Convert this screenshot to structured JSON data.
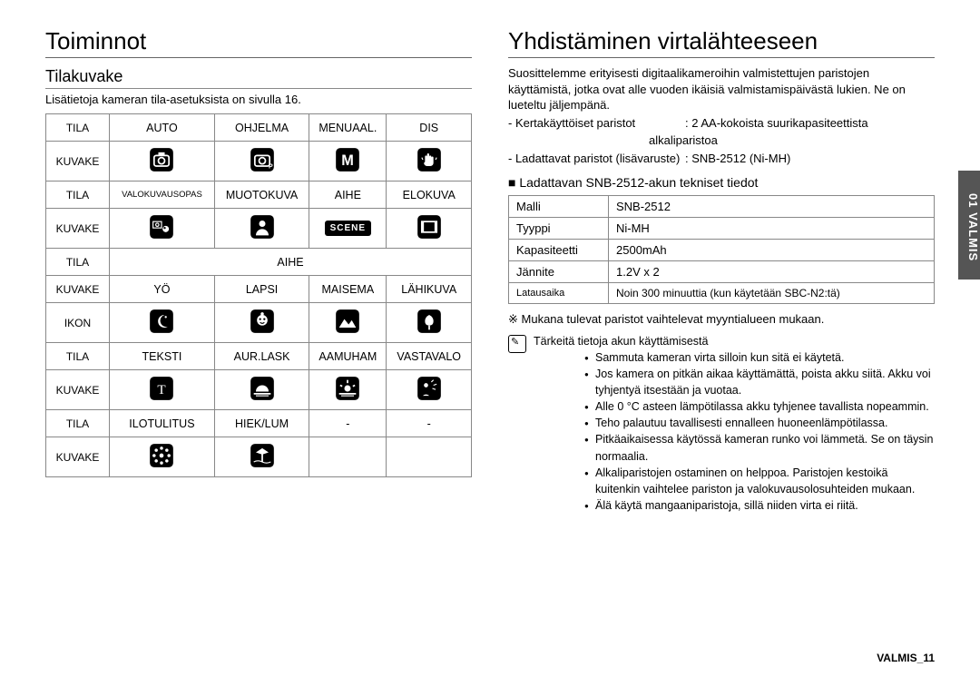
{
  "left": {
    "title": "Toiminnot",
    "subtitle": "Tilakuvake",
    "intro": "Lisätietoja kameran tila-asetuksista on sivulla 16.",
    "labels": {
      "mode": "TILA",
      "icon": "KUVAKE",
      "ikon": "IKON",
      "scene_header": "AIHE"
    },
    "modes_row1": [
      "AUTO",
      "OHJELMA",
      "MENUAAL.",
      "DIS"
    ],
    "icons_row1": [
      "camera-icon",
      "camera-p-icon",
      "letter-m-icon",
      "hand-icon"
    ],
    "modes_row2": [
      "VALOKUVAUSOPAS",
      "MUOTOKUVA",
      "AIHE",
      "ELOKUVA"
    ],
    "icons_row2": [
      "guide-icon",
      "portrait-icon",
      "scene-icon",
      "movie-icon"
    ],
    "scene_modes_row1": [
      "YÖ",
      "LAPSI",
      "MAISEMA",
      "LÄHIKUVA"
    ],
    "scene_icons_row1": [
      "night-icon",
      "child-icon",
      "landscape-icon",
      "macro-icon"
    ],
    "scene_modes_row2": [
      "TEKSTI",
      "AUR.LASK",
      "AAMUHAM",
      "VASTAVALO"
    ],
    "scene_icons_row2": [
      "text-icon",
      "sunset-icon",
      "dawn-icon",
      "backlight-icon"
    ],
    "scene_modes_row3": [
      "ILOTULITUS",
      "HIEK/LUM",
      "-",
      "-"
    ],
    "scene_icons_row3": [
      "fireworks-icon",
      "beach-icon",
      "",
      ""
    ]
  },
  "right": {
    "title": "Yhdistäminen virtalähteeseen",
    "para1": "Suosittelemme erityisesti digitaalikameroihin valmistettujen paristojen käyttämistä, jotka ovat alle vuoden ikäisiä valmistamispäivästä lukien. Ne on lueteltu jäljempänä.",
    "disposable_label": "- Kertakäyttöiset paristot",
    "disposable_value1": ": 2 AA-kokoista suurikapasiteettista",
    "disposable_value2": "alkaliparistoa",
    "rechargeable_label": "- Ladattavat paristot (lisävaruste)",
    "rechargeable_value": ": SNB-2512 (Ni-MH)",
    "spec_title": "■ Ladattavan SNB-2512-akun tekniset tiedot",
    "spec": {
      "model_label": "Malli",
      "model_value": "SNB-2512",
      "type_label": "Tyyppi",
      "type_value": "Ni-MH",
      "capacity_label": "Kapasiteetti",
      "capacity_value": "2500mAh",
      "voltage_label": "Jännite",
      "voltage_value": "1.2V x 2",
      "charge_label": "Latausaika",
      "charge_value": "Noin 300 minuuttia (kun käytetään SBC-N2:tä)"
    },
    "note_star": "※ Mukana tulevat paristot vaihtelevat myyntialueen mukaan.",
    "important_title": "Tärkeitä tietoja akun käyttämisestä",
    "bullets": [
      "Sammuta kameran virta silloin kun sitä ei käytetä.",
      "Jos kamera on pitkän aikaa käyttämättä, poista akku siitä. Akku voi tyhjentyä itsestään ja vuotaa.",
      "Alle 0 °C asteen lämpötilassa akku tyhjenee tavallista nopeammin.",
      "Teho palautuu tavallisesti ennalleen huoneenlämpötilassa.",
      "Pitkäaikaisessa käytössä kameran runko voi lämmetä. Se on täysin normaalia.",
      "Alkaliparistojen ostaminen on helppoa. Paristojen kestoikä kuitenkin vaihtelee pariston ja valokuvausolosuhteiden mukaan.",
      "Älä käytä mangaaniparistoja, sillä niiden virta ei riitä."
    ]
  },
  "side_tab": "01 VALMIS",
  "footer_label": "VALMIS_",
  "footer_page": "11"
}
